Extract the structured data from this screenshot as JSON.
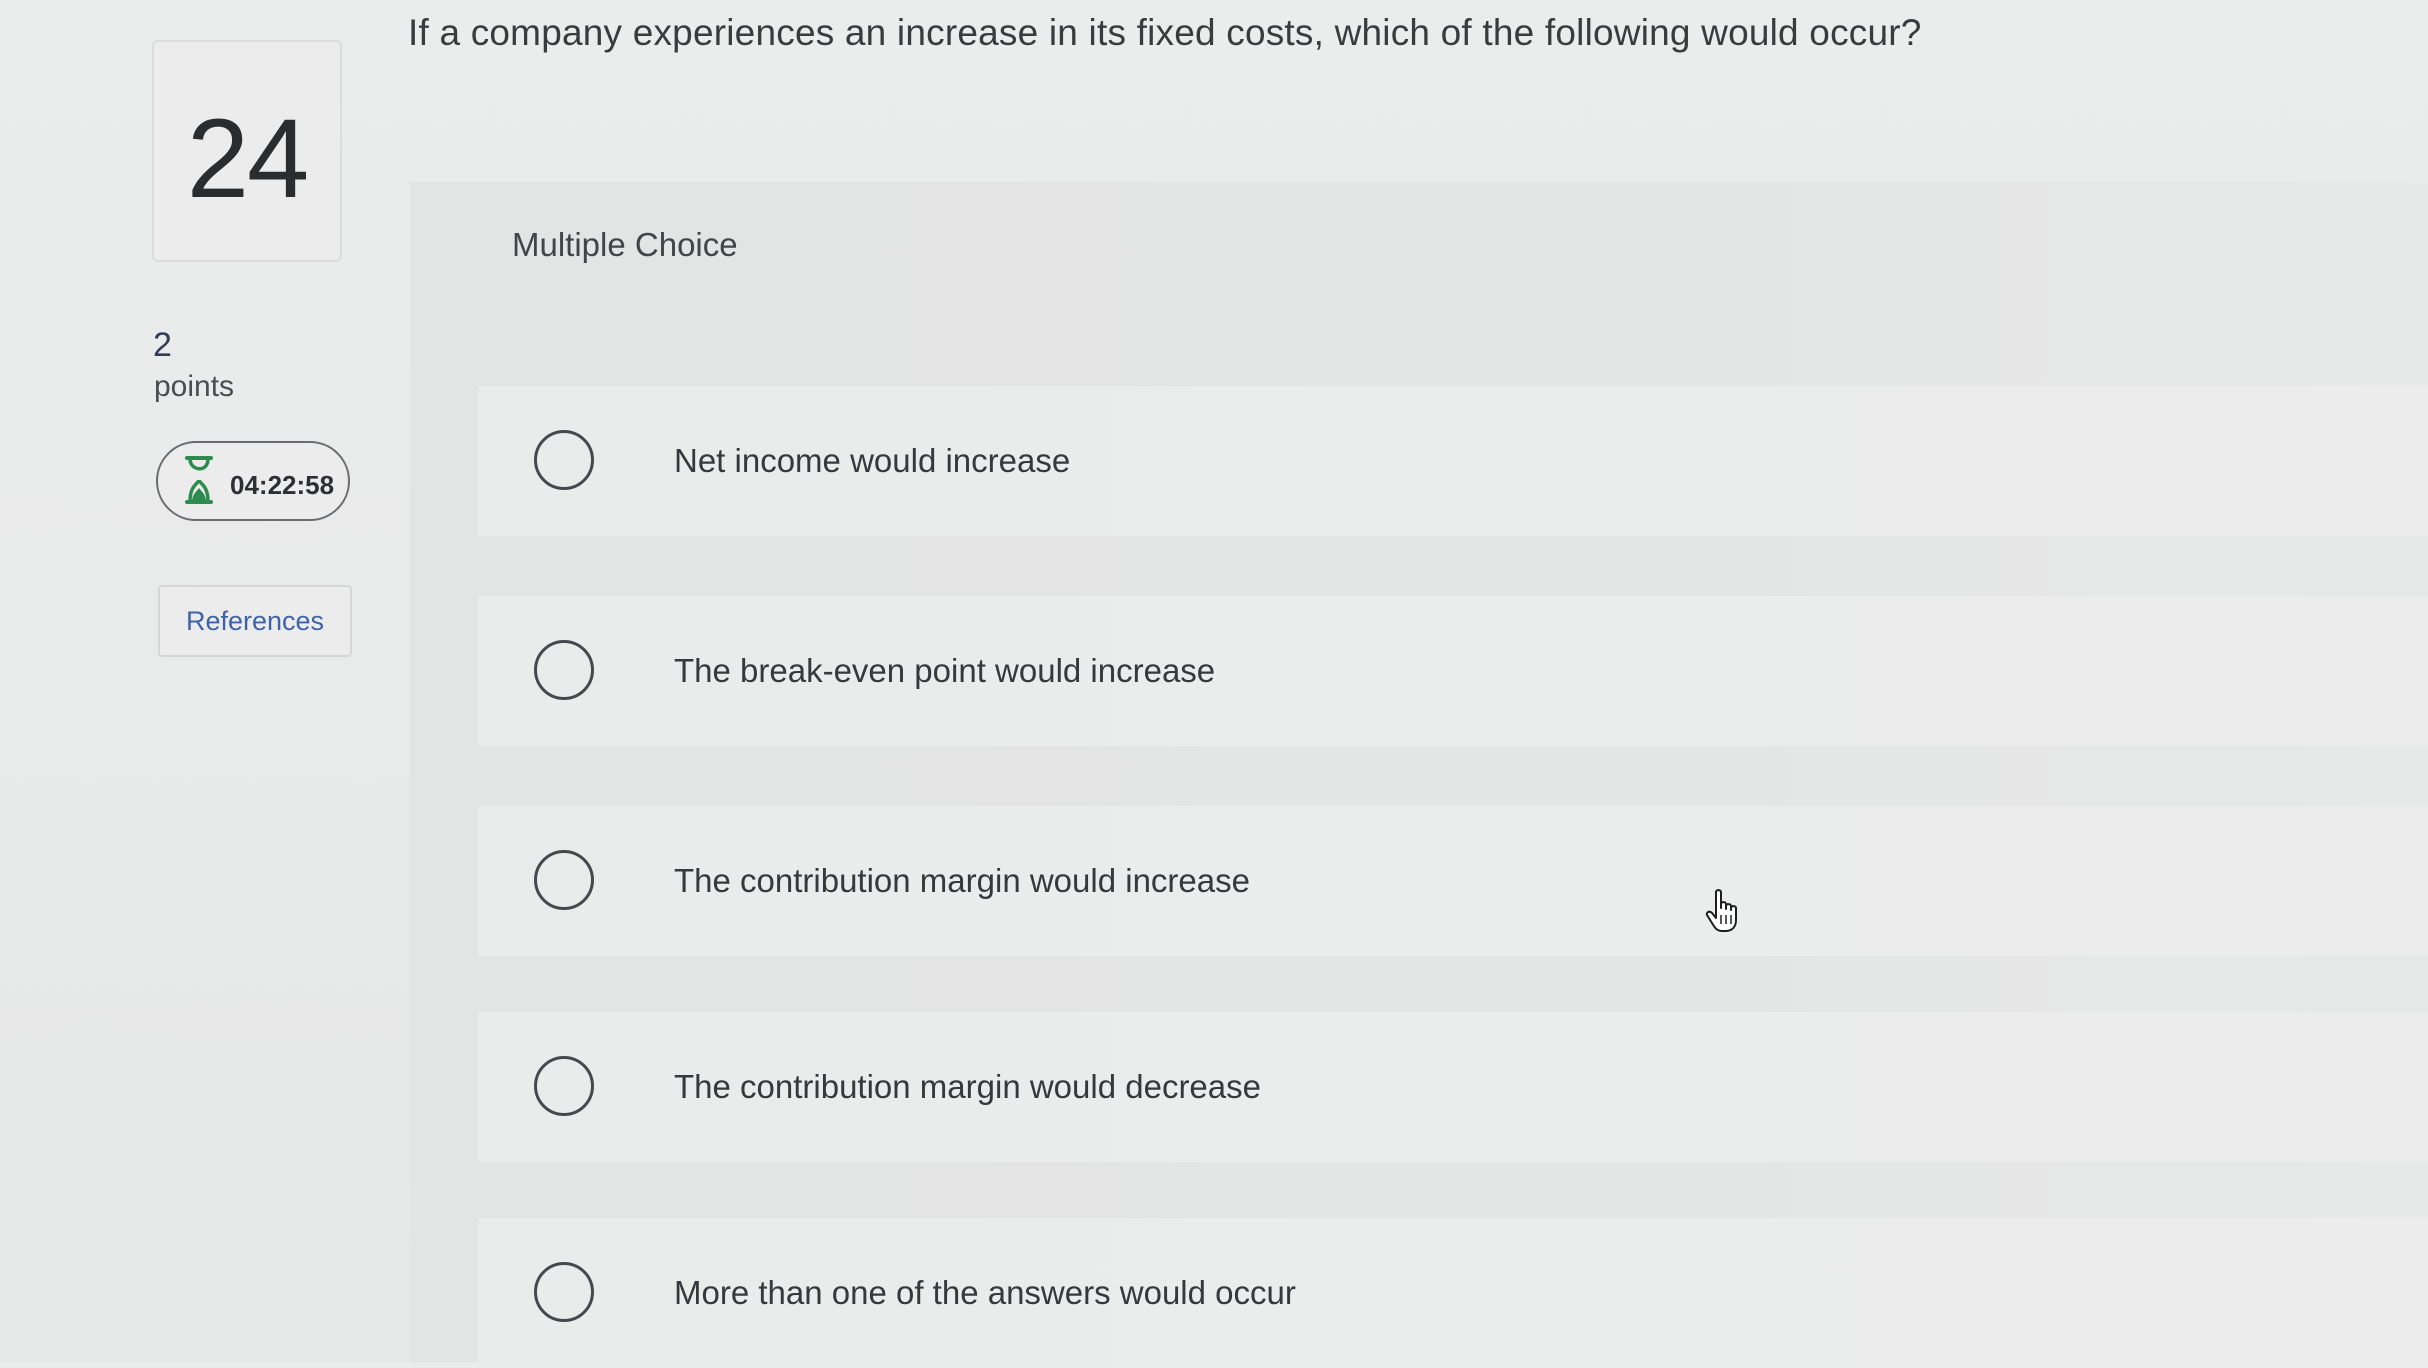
{
  "question": {
    "stem": "If a company experiences an increase in its fixed costs, which of the following would occur?",
    "number": "24",
    "points_value": "2",
    "points_label": "points"
  },
  "timer": {
    "icon": "hourglass-icon",
    "time_remaining": "04:22:58",
    "icon_color": "#2e8b4f"
  },
  "references": {
    "label": "References",
    "color": "#3e63a8"
  },
  "multiple_choice": {
    "label": "Multiple Choice",
    "options": [
      {
        "text": "Net income would increase",
        "selected": false
      },
      {
        "text": "The break-even point would increase",
        "selected": false
      },
      {
        "text": "The contribution margin would increase",
        "selected": false
      },
      {
        "text": "The contribution margin would decrease",
        "selected": false
      },
      {
        "text": "More than one of the answers would occur",
        "selected": false
      }
    ]
  },
  "cursor": {
    "icon": "hand-pointer-cursor-icon"
  }
}
